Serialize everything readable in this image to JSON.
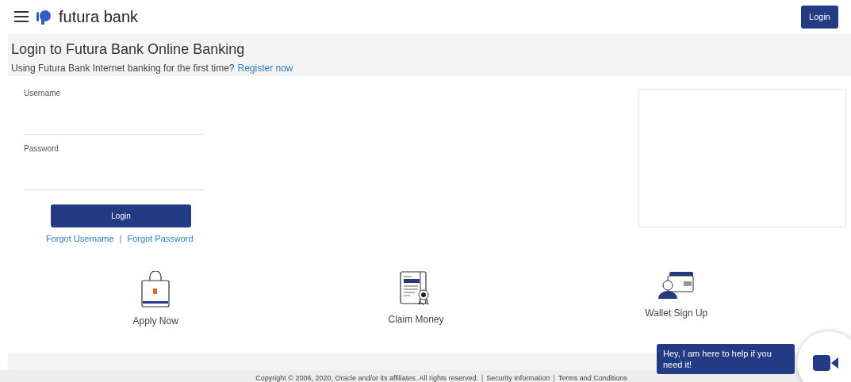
{
  "header": {
    "brand": "futura bank",
    "login_button": "Login"
  },
  "intro": {
    "title": "Login to Futura Bank Online Banking",
    "question": "Using Futura Bank Internet banking for the first time?",
    "register_link": "Register now"
  },
  "form": {
    "fields": [
      {
        "label": "Username"
      },
      {
        "label": "Password"
      }
    ],
    "submit": "Login",
    "links": [
      "Forgot Username",
      "Forgot Password"
    ],
    "separator": "|"
  },
  "services": [
    {
      "kind": "bag",
      "label": "Apply Now"
    },
    {
      "kind": "certificate",
      "label": "Claim Money"
    },
    {
      "kind": "wallet",
      "label": "Wallet Sign Up"
    }
  ],
  "chat": {
    "message": "Hey, I am here to help if you need it!"
  },
  "footer": {
    "copyright": "Copyright © 2006, 2020, Oracle and/or its affiliates. All rights reserved.",
    "links": [
      "Security Information",
      "Terms and Conditions"
    ],
    "separator": "|"
  }
}
